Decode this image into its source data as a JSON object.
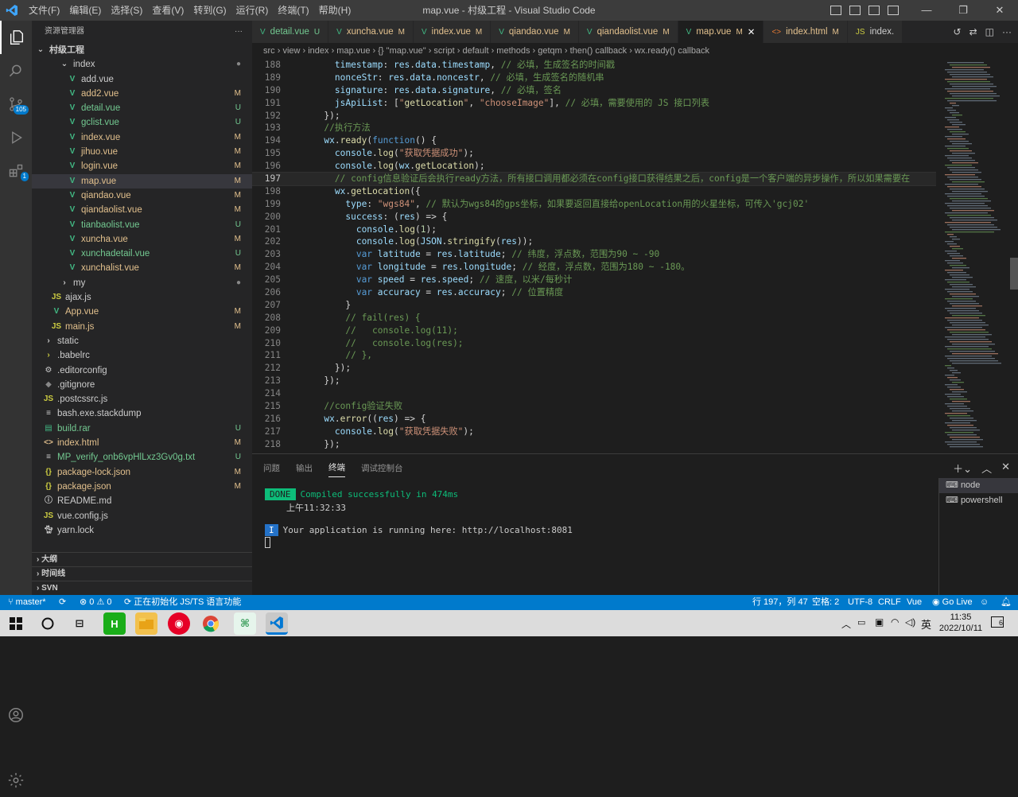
{
  "window": {
    "title": "map.vue - 村级工程 - Visual Studio Code",
    "logo": "vscode-logo"
  },
  "menu": [
    "文件(F)",
    "编辑(E)",
    "选择(S)",
    "查看(V)",
    "转到(G)",
    "运行(R)",
    "终端(T)",
    "帮助(H)"
  ],
  "activity": {
    "scm_badge": "105",
    "ext_badge": "1"
  },
  "explorer": {
    "title": "资源管理器",
    "more": "···",
    "project": "村级工程",
    "items": [
      {
        "name": "index",
        "type": "folder",
        "indent": 2,
        "status": "●"
      },
      {
        "name": "add.vue",
        "type": "vue",
        "indent": 3,
        "status": ""
      },
      {
        "name": "add2.vue",
        "type": "vue",
        "indent": 3,
        "status": "M"
      },
      {
        "name": "detail.vue",
        "type": "vue",
        "indent": 3,
        "status": "U"
      },
      {
        "name": "gclist.vue",
        "type": "vue",
        "indent": 3,
        "status": "U"
      },
      {
        "name": "index.vue",
        "type": "vue",
        "indent": 3,
        "status": "M"
      },
      {
        "name": "jihuo.vue",
        "type": "vue",
        "indent": 3,
        "status": "M"
      },
      {
        "name": "login.vue",
        "type": "vue",
        "indent": 3,
        "status": "M"
      },
      {
        "name": "map.vue",
        "type": "vue",
        "indent": 3,
        "status": "M",
        "selected": true
      },
      {
        "name": "qiandao.vue",
        "type": "vue",
        "indent": 3,
        "status": "M"
      },
      {
        "name": "qiandaolist.vue",
        "type": "vue",
        "indent": 3,
        "status": "M"
      },
      {
        "name": "tianbaolist.vue",
        "type": "vue",
        "indent": 3,
        "status": "U"
      },
      {
        "name": "xuncha.vue",
        "type": "vue",
        "indent": 3,
        "status": "M"
      },
      {
        "name": "xunchadetail.vue",
        "type": "vue",
        "indent": 3,
        "status": "U"
      },
      {
        "name": "xunchalist.vue",
        "type": "vue",
        "indent": 3,
        "status": "M"
      },
      {
        "name": "my",
        "type": "folder-closed",
        "indent": 2,
        "status": "●"
      },
      {
        "name": "ajax.js",
        "type": "js",
        "indent": 1,
        "status": ""
      },
      {
        "name": "App.vue",
        "type": "vue",
        "indent": 1,
        "status": "M"
      },
      {
        "name": "main.js",
        "type": "js",
        "indent": 1,
        "status": "M"
      },
      {
        "name": "static",
        "type": "folder-closed",
        "indent": 0,
        "status": ""
      },
      {
        "name": ".babelrc",
        "type": "babel",
        "indent": 0,
        "status": ""
      },
      {
        "name": ".editorconfig",
        "type": "gear",
        "indent": 0,
        "status": ""
      },
      {
        "name": ".gitignore",
        "type": "git",
        "indent": 0,
        "status": ""
      },
      {
        "name": ".postcssrc.js",
        "type": "js",
        "indent": 0,
        "status": ""
      },
      {
        "name": "bash.exe.stackdump",
        "type": "plain",
        "indent": 0,
        "status": ""
      },
      {
        "name": "build.rar",
        "type": "rar",
        "indent": 0,
        "status": "U"
      },
      {
        "name": "index.html",
        "type": "html",
        "indent": 0,
        "status": "M"
      },
      {
        "name": "MP_verify_onb6vpHlLxz3Gv0g.txt",
        "type": "plain",
        "indent": 0,
        "status": "U"
      },
      {
        "name": "package-lock.json",
        "type": "json",
        "indent": 0,
        "status": "M"
      },
      {
        "name": "package.json",
        "type": "json",
        "indent": 0,
        "status": "M"
      },
      {
        "name": "README.md",
        "type": "info",
        "indent": 0,
        "status": ""
      },
      {
        "name": "vue.config.js",
        "type": "js",
        "indent": 0,
        "status": ""
      },
      {
        "name": "yarn.lock",
        "type": "yarn",
        "indent": 0,
        "status": ""
      }
    ],
    "sections": [
      "大纲",
      "时间线",
      "SVN"
    ]
  },
  "tabs": [
    {
      "label": "detail.vue",
      "status": "U",
      "icon": "V"
    },
    {
      "label": "xuncha.vue",
      "status": "M",
      "icon": "V"
    },
    {
      "label": "index.vue",
      "status": "M",
      "icon": "V"
    },
    {
      "label": "qiandao.vue",
      "status": "M",
      "icon": "V"
    },
    {
      "label": "qiandaolist.vue",
      "status": "M",
      "icon": "V"
    },
    {
      "label": "map.vue",
      "status": "M",
      "icon": "V",
      "active": true
    },
    {
      "label": "index.html",
      "status": "M",
      "icon": "<>"
    },
    {
      "label": "index.",
      "status": "",
      "icon": "JS"
    }
  ],
  "breadcrumb": "src  ›  view  ›  index  ›  map.vue  ›  {} \"map.vue\"  ›  script  ›  default  ›  methods  ›  getqm  ›  then() callback  ›  wx.ready() callback",
  "editor": {
    "current_line": 197,
    "lines": [
      {
        "n": "188",
        "t": "        timestamp: res.data.timestamp, // 必填，生成签名的时间戳"
      },
      {
        "n": "189",
        "t": "        nonceStr: res.data.noncestr, // 必填，生成签名的随机串"
      },
      {
        "n": "190",
        "t": "        signature: res.data.signature, // 必填，签名"
      },
      {
        "n": "191",
        "t": "        jsApiList: [\"getLocation\", \"chooseImage\"], // 必填，需要使用的 JS 接口列表"
      },
      {
        "n": "192",
        "t": "      });"
      },
      {
        "n": "193",
        "t": "      //执行方法"
      },
      {
        "n": "194",
        "t": "      wx.ready(function() {"
      },
      {
        "n": "195",
        "t": "        console.log(\"获取凭据成功\");"
      },
      {
        "n": "196",
        "t": "        console.log(wx.getLocation);"
      },
      {
        "n": "197",
        "t": "        // config信息验证后会执行ready方法，所有接口调用都必须在config接口获得结果之后，config是一个客户端的异步操作，所以如果需要在"
      },
      {
        "n": "198",
        "t": "        wx.getLocation({"
      },
      {
        "n": "199",
        "t": "          type: \"wgs84\", // 默认为wgs84的gps坐标，如果要返回直接给openLocation用的火星坐标，可传入'gcj02'"
      },
      {
        "n": "200",
        "t": "          success: (res) => {"
      },
      {
        "n": "201",
        "t": "            console.log(1);"
      },
      {
        "n": "202",
        "t": "            console.log(JSON.stringify(res));"
      },
      {
        "n": "203",
        "t": "            var latitude = res.latitude; // 纬度，浮点数，范围为90 ~ -90"
      },
      {
        "n": "204",
        "t": "            var longitude = res.longitude; // 经度，浮点数，范围为180 ~ -180。"
      },
      {
        "n": "205",
        "t": "            var speed = res.speed; // 速度，以米/每秒计"
      },
      {
        "n": "206",
        "t": "            var accuracy = res.accuracy; // 位置精度"
      },
      {
        "n": "207",
        "t": "          }"
      },
      {
        "n": "208",
        "t": "          // fail(res) {"
      },
      {
        "n": "209",
        "t": "          //   console.log(11);"
      },
      {
        "n": "210",
        "t": "          //   console.log(res);"
      },
      {
        "n": "211",
        "t": "          // },"
      },
      {
        "n": "212",
        "t": "        });"
      },
      {
        "n": "213",
        "t": "      });"
      },
      {
        "n": "214",
        "t": ""
      },
      {
        "n": "215",
        "t": "      //config验证失败"
      },
      {
        "n": "216",
        "t": "      wx.error((res) => {"
      },
      {
        "n": "217",
        "t": "        console.log(\"获取凭据失败\");"
      },
      {
        "n": "218",
        "t": "      });"
      }
    ]
  },
  "panel": {
    "tabs": [
      "问题",
      "输出",
      "终端",
      "调试控制台"
    ],
    "active_tab": "终端",
    "done_label": "DONE",
    "compiled": "Compiled successfully in 474ms",
    "time": "上午11:32:33",
    "info_label": "I",
    "running": "Your application is running here: http://localhost:8081",
    "terminals": [
      "node",
      "powershell"
    ]
  },
  "statusbar": {
    "branch": "master*",
    "errors": "0",
    "warnings": "0",
    "init": "正在初始化 JS/TS 语言功能",
    "position": "行 197，列 47",
    "spaces": "空格: 2",
    "encoding": "UTF-8",
    "eol": "CRLF",
    "lang": "Vue",
    "golive": "Go Live"
  },
  "taskbar": {
    "ime": "英",
    "time": "11:35",
    "date": "2022/10/11",
    "notif": "6"
  },
  "colors": {
    "accent": "#007acc",
    "modified": "#e2c08d",
    "untracked": "#73c991"
  }
}
